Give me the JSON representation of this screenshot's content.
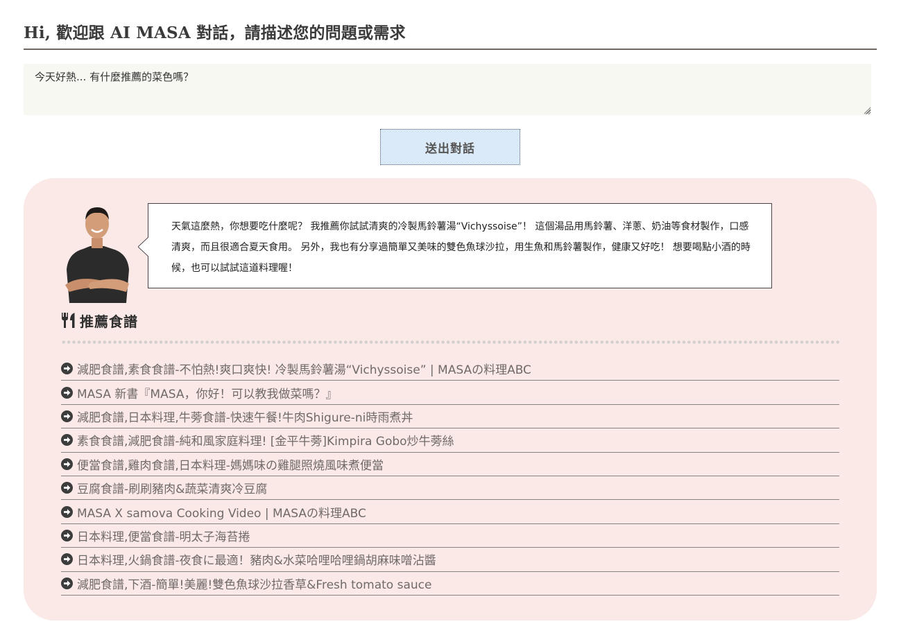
{
  "header": {
    "title": "Hi, 歡迎跟 AI MASA 對話，請描述您的問題或需求"
  },
  "chat": {
    "input_value": "今天好熱... 有什麼推薦的菜色嗎？",
    "send_label": "送出對話"
  },
  "response": {
    "avatar_icon": "masa-chef-portrait",
    "message": "天氣這麼熱，你想要吃什麼呢？ 我推薦你試試清爽的冷製馬鈴薯湯“Vichyssoise”！ 這個湯品用馬鈴薯、洋蔥、奶油等食材製作，口感清爽，而且很適合夏天食用。 另外，我也有分享過簡單又美味的雙色魚球沙拉，用生魚和馬鈴薯製作，健康又好吃！ 想要喝點小酒的時候，也可以試試這道料理喔！"
  },
  "recommendations": {
    "icon": "utensils-icon",
    "title": "推薦食譜",
    "item_icon": "circle-arrow-right-icon",
    "items": [
      "減肥食譜,素食食譜-不怕熱!爽口爽快! 冷製馬鈴薯湯“Vichyssoise” | MASAの料理ABC",
      "MASA 新書『MASA，你好！可以教我做菜嗎？』",
      "減肥食譜,日本料理,牛蒡食譜-快速午餐!牛肉Shigure-ni時雨煮丼",
      "素食食譜,減肥食譜-純和風家庭料理! [金平牛蒡]Kimpira Gobo炒牛蒡絲",
      "便當食譜,雞肉食譜,日本料理-媽媽味の雞腿照燒風味煮便當",
      "豆腐食譜-刷刷豬肉&蔬菜清爽冷豆腐",
      "MASA X samova Cooking Video | MASAの料理ABC",
      "日本料理,便當食譜-明太子海苔捲",
      "日本料理,火鍋食譜-夜食に最適！豬肉&水菜哈哩哈哩鍋胡麻味噌沾醬",
      "減肥食譜,下酒-簡單!美麗!雙色魚球沙拉香草&Fresh tomato sauce"
    ]
  },
  "colors": {
    "panel_bg": "#fbe9e8",
    "button_bg": "#dbeaf8",
    "input_bg": "#f8f8f3",
    "link_text": "#6f6a68",
    "heading_rule": "#6e6762"
  }
}
